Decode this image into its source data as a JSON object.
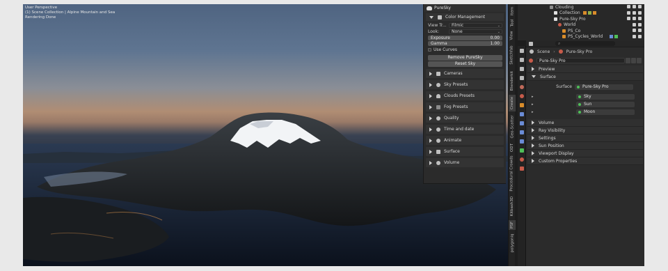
{
  "viewport": {
    "perspective": "User Perspective",
    "collection": "(1) Scene Collection | Alpine Mountain and Sea",
    "status": "Rendering Done"
  },
  "puresky_panel": {
    "title": "PureSky",
    "color_management": {
      "label": "Color Management",
      "view_transform_label": "View Tr...",
      "view_transform_value": "Filmic",
      "look_label": "Look:",
      "look_value": "None",
      "exposure_label": "Exposure",
      "exposure_value": "0.00",
      "gamma_label": "Gamma",
      "gamma_value": "1.00",
      "use_curves_label": "Use Curves",
      "remove_button": "Remove PureSky",
      "reset_button": "Reset Sky"
    },
    "sections": [
      {
        "label": "Cameras",
        "icon": "camera-icon"
      },
      {
        "label": "Sky Presets",
        "icon": "gear-icon"
      },
      {
        "label": "Clouds Presets",
        "icon": "cloud-icon"
      },
      {
        "label": "Fog Presets",
        "icon": "fog-icon"
      },
      {
        "label": "Quality",
        "icon": "quality-icon"
      },
      {
        "label": "Time and date",
        "icon": "clock-icon"
      },
      {
        "label": "Animate",
        "icon": "animate-icon"
      },
      {
        "label": "Surface",
        "icon": "brush-icon"
      },
      {
        "label": "Volume",
        "icon": "volume-icon"
      }
    ]
  },
  "tabs": [
    "Item",
    "Tool",
    "View",
    "Sketchfab",
    "Blenderkit",
    "Create",
    "Geo-Scatter",
    "ODT",
    "Procedural Crowds",
    "Kitbash3D",
    "PSF",
    "polygoniq"
  ],
  "outliner": {
    "rows": [
      {
        "label": "Clouding"
      },
      {
        "label": "Collection"
      },
      {
        "label": "Pure-Sky Pro"
      },
      {
        "label": "World"
      },
      {
        "label": "PS_Co"
      },
      {
        "label": "PS_Cycles_World"
      }
    ]
  },
  "properties": {
    "search_placeholder": "",
    "breadcrumb": [
      "Scene",
      "Pure-Sky Pro"
    ],
    "world_name": "Pure-Sky Pro",
    "sections": {
      "preview": "Preview",
      "surface": "Surface",
      "volume": "Volume",
      "ray_visibility": "Ray Visibility",
      "settings": "Settings",
      "sun_position": "Sun Position",
      "viewport_display": "Viewport Display",
      "custom_properties": "Custom Properties"
    },
    "surface_label": "Surface",
    "surface_value": "Pure-Sky Pro",
    "inputs": [
      "Sky",
      "Sun",
      "Moon"
    ]
  },
  "colors": {
    "node_green": "#4fbf58",
    "panel_bg": "#2b2b2b",
    "button_bg": "#545454"
  }
}
